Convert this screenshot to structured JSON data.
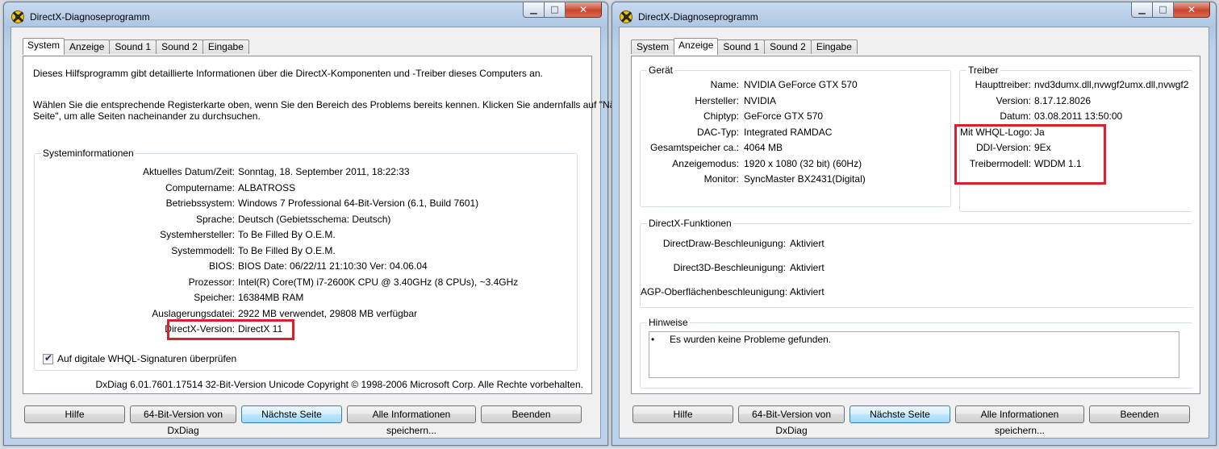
{
  "left_window": {
    "title": "DirectX-Diagnoseprogramm",
    "tabs": [
      "System",
      "Anzeige",
      "Sound 1",
      "Sound 2",
      "Eingabe"
    ],
    "active_tab": "System",
    "intro1": "Dieses Hilfsprogramm gibt detaillierte Informationen über die DirectX-Komponenten und -Treiber dieses Computers an.",
    "intro2_line1": "Wählen Sie die entsprechende Registerkarte oben, wenn Sie den Bereich des Problems bereits kennen. Klicken Sie andernfalls auf \"Nächste",
    "intro2_line2": "Seite\", um alle Seiten nacheinander zu durchsuchen.",
    "group_title": "Systeminformationen",
    "rows": [
      {
        "label": "Aktuelles Datum/Zeit:",
        "value": "Sonntag, 18. September 2011, 18:22:33"
      },
      {
        "label": "Computername:",
        "value": "ALBATROSS"
      },
      {
        "label": "Betriebssystem:",
        "value": "Windows 7 Professional 64-Bit-Version (6.1, Build 7601)"
      },
      {
        "label": "Sprache:",
        "value": "Deutsch (Gebietsschema: Deutsch)"
      },
      {
        "label": "Systemhersteller:",
        "value": "To Be Filled By O.E.M."
      },
      {
        "label": "Systemmodell:",
        "value": "To Be Filled By O.E.M."
      },
      {
        "label": "BIOS:",
        "value": "BIOS Date: 06/22/11 21:10:30 Ver: 04.06.04"
      },
      {
        "label": "Prozessor:",
        "value": "Intel(R) Core(TM) i7-2600K CPU @ 3.40GHz (8 CPUs), ~3.4GHz"
      },
      {
        "label": "Speicher:",
        "value": "16384MB RAM"
      },
      {
        "label": "Auslagerungsdatei:",
        "value": "2922 MB verwendet, 29808 MB verfügbar"
      },
      {
        "label": "DirectX-Version:",
        "value": "DirectX 11"
      }
    ],
    "checkbox_label": "Auf digitale WHQL-Signaturen überprüfen",
    "checkbox_checked": true,
    "footer": "DxDiag 6.01.7601.17514 32-Bit-Version Unicode Copyright © 1998-2006 Microsoft Corp. Alle Rechte vorbehalten.",
    "buttons": [
      "Hilfe",
      "64-Bit-Version von DxDiag",
      "Nächste Seite",
      "Alle Informationen speichern...",
      "Beenden"
    ]
  },
  "right_window": {
    "title": "DirectX-Diagnoseprogramm",
    "tabs": [
      "System",
      "Anzeige",
      "Sound 1",
      "Sound 2",
      "Eingabe"
    ],
    "active_tab": "Anzeige",
    "device_title": "Gerät",
    "device_rows": [
      {
        "label": "Name:",
        "value": "NVIDIA GeForce GTX 570"
      },
      {
        "label": "Hersteller:",
        "value": "NVIDIA"
      },
      {
        "label": "Chiptyp:",
        "value": "GeForce GTX 570"
      },
      {
        "label": "DAC-Typ:",
        "value": "Integrated RAMDAC"
      },
      {
        "label": "Gesamtspeicher ca.:",
        "value": "4064 MB"
      },
      {
        "label": "Anzeigemodus:",
        "value": "1920 x 1080 (32 bit) (60Hz)"
      },
      {
        "label": "Monitor:",
        "value": "SyncMaster BX2431(Digital)"
      }
    ],
    "driver_title": "Treiber",
    "driver_rows": [
      {
        "label": "Haupttreiber:",
        "value": "nvd3dumx.dll,nvwgf2umx.dll,nvwgf2"
      },
      {
        "label": "Version:",
        "value": "8.17.12.8026"
      },
      {
        "label": "Datum:",
        "value": "03.08.2011 13:50:00"
      },
      {
        "label": "Mit WHQL-Logo:",
        "value": "Ja"
      },
      {
        "label": "DDI-Version:",
        "value": "9Ex"
      },
      {
        "label": "Treibermodell:",
        "value": "WDDM 1.1"
      }
    ],
    "functions_title": "DirectX-Funktionen",
    "function_rows": [
      {
        "label": "DirectDraw-Beschleunigung:",
        "value": "Aktiviert"
      },
      {
        "label": "Direct3D-Beschleunigung:",
        "value": "Aktiviert"
      },
      {
        "label": "AGP-Oberflächenbeschleunigung:",
        "value": "Aktiviert"
      }
    ],
    "notes_title": "Hinweise",
    "notes_bullet": "•",
    "notes_text": "Es wurden keine Probleme gefunden.",
    "buttons": [
      "Hilfe",
      "64-Bit-Version von DxDiag",
      "Nächste Seite",
      "Alle Informationen speichern...",
      "Beenden"
    ]
  },
  "colors": {
    "highlight_box": "#d8212b",
    "close_button": "#c8462b",
    "default_button_border": "#3c7fb1"
  }
}
